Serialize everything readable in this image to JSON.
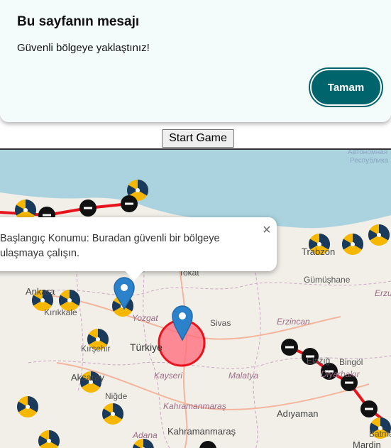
{
  "dialog": {
    "title": "Bu sayfanın mesajı",
    "message": "Güvenli bölgeye yaklaştınız!",
    "ok_label": "Tamam"
  },
  "start_button_label": "Start Game",
  "popup": {
    "text": "Başlangıç Konumu: Buradan güvenli bir bölgeye ulaşmaya çalışın.",
    "close": "×"
  },
  "map_labels": {
    "republic": "Республика",
    "avtonomnaya": "Автономная",
    "trabzon": "Trabzon",
    "gumushane": "Gümüşhane",
    "erzurum": "Erzu",
    "tokat": "Tokat",
    "ankara": "Ankara",
    "kirikkale": "Kırıkkale",
    "yozgat": "Yozgat",
    "sivas": "Sivas",
    "erzincan": "Erzincan",
    "kirsehir": "Kırşehir",
    "turkiye": "Türkiye",
    "aksaray": "Aksaray",
    "kayseri": "Kayseri",
    "malatya": "Malatya",
    "elazig": "Elazığ",
    "bingol": "Bingöl",
    "diyarbakir": "Diyarbakır",
    "nigde": "Niğde",
    "kahramanmaras_it": "Kahramanmaraş",
    "adiyaman": "Adıyaman",
    "kahramanmaras": "Kahramanmaraş",
    "adana": "Adana",
    "mardin": "Mardin",
    "batman": "Batman"
  },
  "colors": {
    "accent": "#00646c",
    "route": "#e8141d",
    "safe_zone": "#ff6f80",
    "marker": "#2b82cb"
  }
}
